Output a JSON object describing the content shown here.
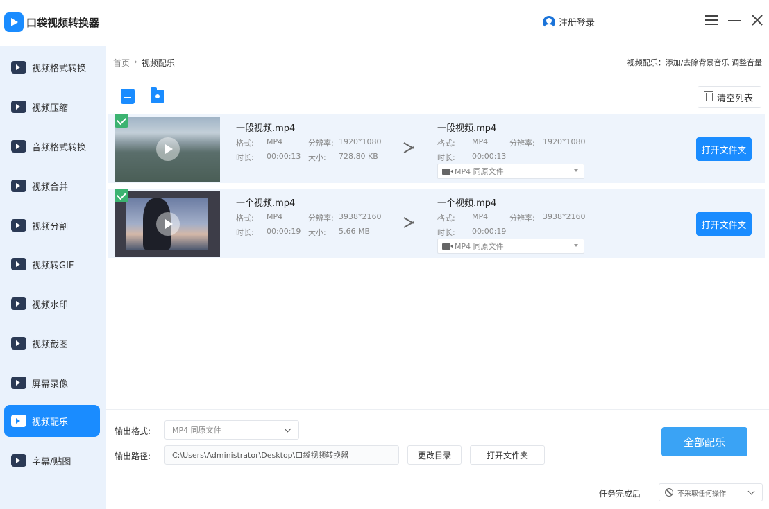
{
  "app": {
    "title": "口袋视频转换器",
    "login_label": "注册登录"
  },
  "sidebar": {
    "items": [
      {
        "label": "视频格式转换",
        "icon": "video-convert-icon",
        "active": false
      },
      {
        "label": "视频压缩",
        "icon": "compress-icon",
        "active": false
      },
      {
        "label": "音频格式转换",
        "icon": "audio-convert-icon",
        "active": false
      },
      {
        "label": "视频合并",
        "icon": "merge-icon",
        "active": false
      },
      {
        "label": "视频分割",
        "icon": "split-icon",
        "active": false
      },
      {
        "label": "视频转GIF",
        "icon": "gif-icon",
        "active": false
      },
      {
        "label": "视频水印",
        "icon": "watermark-icon",
        "active": false
      },
      {
        "label": "视频截图",
        "icon": "screenshot-icon",
        "active": false
      },
      {
        "label": "屏幕录像",
        "icon": "screen-record-icon",
        "active": false
      },
      {
        "label": "视频配乐",
        "icon": "music-icon",
        "active": true
      },
      {
        "label": "字幕/贴图",
        "icon": "subtitle-icon",
        "active": false
      }
    ]
  },
  "breadcrumb": {
    "home": "首页",
    "separator": "›",
    "current": "视频配乐"
  },
  "hint": "视频配乐：添加/去除背景音乐 调整音量",
  "toolbar": {
    "clear_label": "清空列表"
  },
  "files": [
    {
      "source_name": "一段视频.mp4",
      "format_label": "格式:",
      "format": "MP4",
      "res_label": "分辨率:",
      "resolution": "1920*1080",
      "duration_label": "时长:",
      "duration": "00:00:13",
      "size_label": "大小:",
      "size": "728.80 KB",
      "output_name": "一段视频.mp4",
      "out_format": "MP4",
      "out_resolution": "1920*1080",
      "out_duration": "00:00:13",
      "select_value": "MP4  同原文件",
      "open_label": "打开文件夹"
    },
    {
      "source_name": "一个视频.mp4",
      "format_label": "格式:",
      "format": "MP4",
      "res_label": "分辨率:",
      "resolution": "3938*2160",
      "duration_label": "时长:",
      "duration": "00:00:19",
      "size_label": "大小:",
      "size": "5.66 MB",
      "output_name": "一个视频.mp4",
      "out_format": "MP4",
      "out_resolution": "3938*2160",
      "out_duration": "00:00:19",
      "select_value": "MP4  同原文件",
      "open_label": "打开文件夹"
    }
  ],
  "footer": {
    "output_format_label": "输出格式:",
    "output_format_value": "MP4  同原文件",
    "output_path_label": "输出路径:",
    "output_path_value": "C:\\Users\\Administrator\\Desktop\\口袋视频转换器",
    "change_dir_label": "更改目录",
    "open_folder_label": "打开文件夹",
    "start_label": "全部配乐",
    "after_task_label": "任务完成后",
    "after_task_value": "不采取任何操作"
  }
}
